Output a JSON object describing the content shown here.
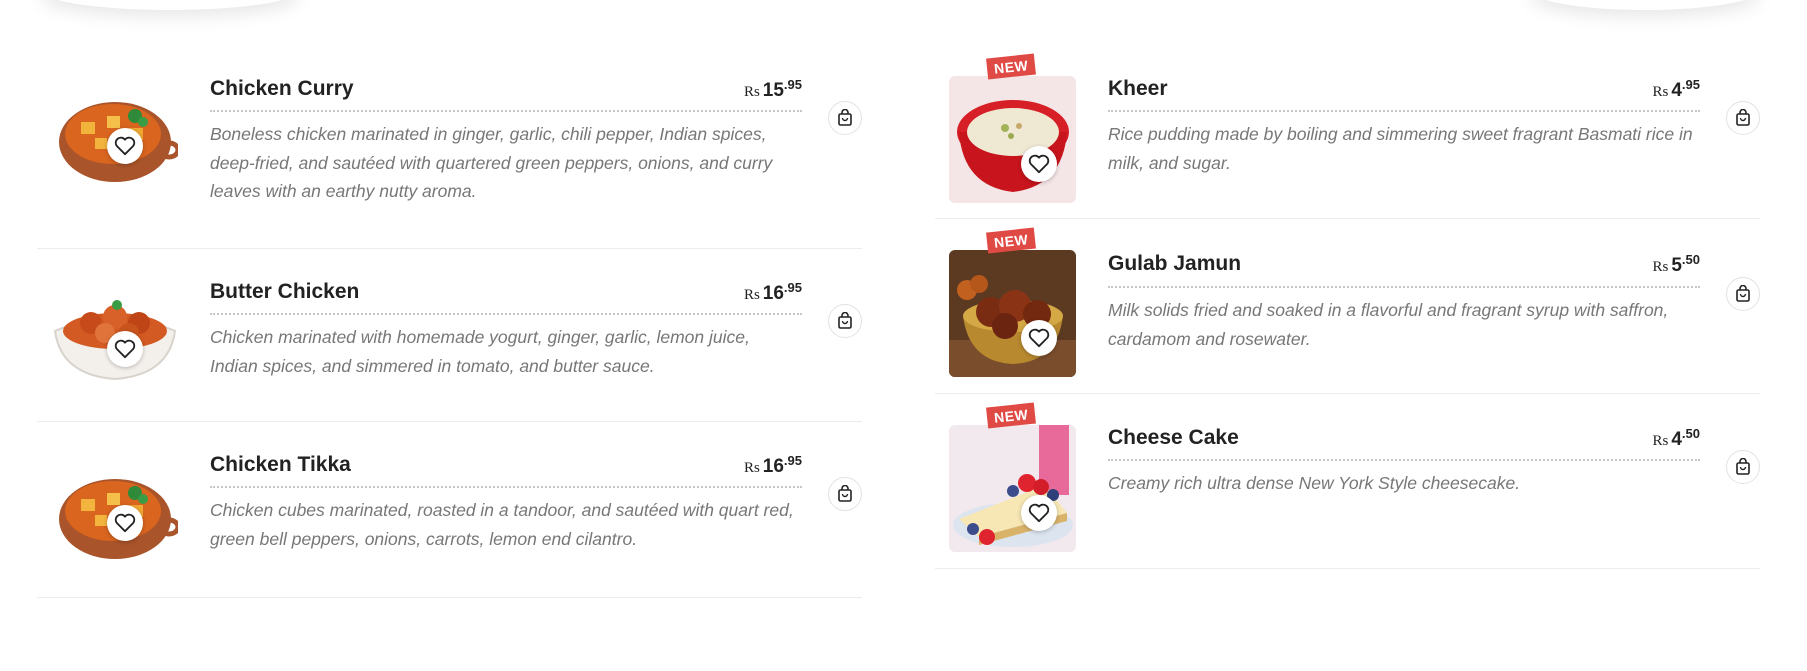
{
  "currency": "Rs",
  "badge_new": "NEW",
  "left_items": [
    {
      "name": "Chicken Curry",
      "price_whole": "15",
      "price_dec": ".95",
      "desc": "Boneless chicken marinated in ginger, garlic, chili pepper, Indian spices, deep-fried, and sautéed with quartered green peppers, onions, and curry leaves with an earthy nutty aroma.",
      "image": "chicken-curry-dish",
      "new": false
    },
    {
      "name": "Butter Chicken",
      "price_whole": "16",
      "price_dec": ".95",
      "desc": "Chicken marinated with homemade yogurt, ginger, garlic, lemon juice, Indian spices, and simmered in tomato, and butter sauce.",
      "image": "butter-chicken-bowl",
      "new": false
    },
    {
      "name": "Chicken Tikka",
      "price_whole": "16",
      "price_dec": ".95",
      "desc": "Chicken cubes marinated, roasted in a tandoor, and sautéed with quart red, green bell peppers, onions, carrots, lemon end cilantro.",
      "image": "chicken-tikka-dish",
      "new": false
    }
  ],
  "right_items": [
    {
      "name": "Kheer",
      "price_whole": "4",
      "price_dec": ".95",
      "desc": "Rice pudding made by boiling and simmering sweet fragrant Basmati rice in milk, and sugar.",
      "image": "kheer-bowl",
      "new": true
    },
    {
      "name": "Gulab Jamun",
      "price_whole": "5",
      "price_dec": ".50",
      "desc": "Milk solids fried and soaked in a flavorful and fragrant syrup with saf­fron, cardamom and rosewater.",
      "image": "gulab-jamun-bowl",
      "new": true
    },
    {
      "name": "Cheese Cake",
      "price_whole": "4",
      "price_dec": ".50",
      "desc": "Creamy rich ultra dense New York Style cheesecake.",
      "image": "cheesecake-slice",
      "new": true
    }
  ],
  "icons": {
    "wishlist": "heart-icon",
    "cart": "shopping-bag-icon"
  },
  "colors": {
    "badge": "#e04a45",
    "text": "#222222",
    "desc": "#777777"
  }
}
